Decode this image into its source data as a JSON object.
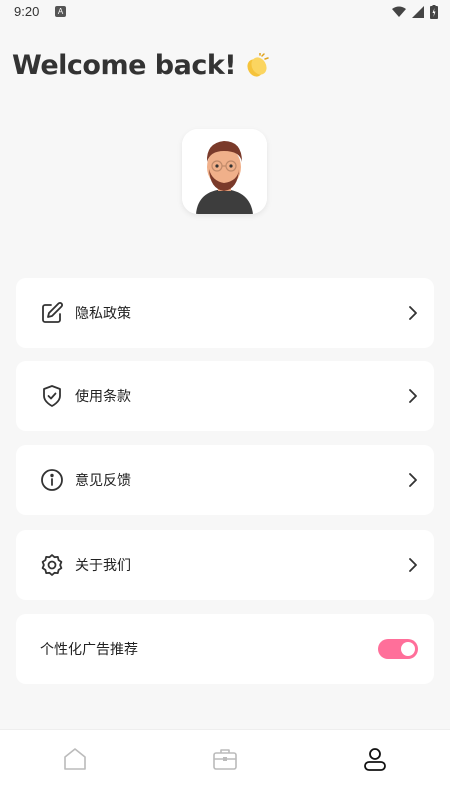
{
  "status_bar": {
    "time": "9:20",
    "notification_letter": "A"
  },
  "header": {
    "title": "Welcome back!",
    "emoji_icon": "clapping-hands-icon"
  },
  "menu": {
    "items": [
      {
        "label": "隐私政策",
        "icon": "edit-icon"
      },
      {
        "label": "使用条款",
        "icon": "shield-check-icon"
      },
      {
        "label": "意见反馈",
        "icon": "info-icon"
      },
      {
        "label": "关于我们",
        "icon": "gear-icon"
      }
    ],
    "ad_toggle": {
      "label": "个性化广告推荐",
      "enabled": true
    }
  },
  "bottom_nav": {
    "items": [
      "home-icon",
      "briefcase-icon",
      "profile-icon"
    ],
    "active": "profile-icon"
  },
  "colors": {
    "accent": "#ff6f9a",
    "background": "#f7f7f7",
    "card": "#ffffff"
  }
}
